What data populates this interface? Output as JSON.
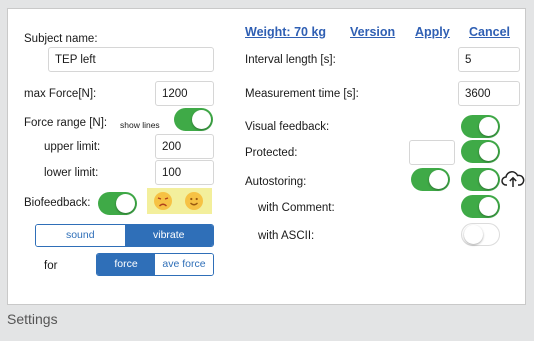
{
  "left": {
    "subject_label": "Subject name:",
    "subject_value": "TEP left",
    "max_force_label": "max Force[N]:",
    "max_force_value": "1200",
    "force_range_label": "Force range [N]:",
    "show_lines_label": "show lines",
    "upper_label": "upper limit:",
    "upper_value": "200",
    "lower_label": "lower limit:",
    "lower_value": "100",
    "biofeedback_label": "Biofeedback:",
    "mode_options": [
      "sound",
      "vibrate"
    ],
    "mode_selected": "vibrate",
    "for_label": "for",
    "for_options": [
      "force",
      "ave force"
    ],
    "for_selected": "force"
  },
  "top_links": {
    "weight": "Weight: 70 kg",
    "version": "Version",
    "apply": "Apply",
    "cancel": "Cancel"
  },
  "right": {
    "interval_label": "Interval length [s]:",
    "interval_value": "5",
    "measurement_label": "Measurement time [s]:",
    "measurement_value": "3600",
    "visual_label": "Visual feedback:",
    "protected_label": "Protected:",
    "autostoring_label": "Autostoring:",
    "comment_label": "with Comment:",
    "ascii_label": "with ASCII:"
  },
  "toggles": {
    "show_lines": true,
    "biofeedback": true,
    "visual_feedback": true,
    "protected": true,
    "autostoring_a": true,
    "autostoring_b": true,
    "with_comment": true,
    "with_ascii": false
  },
  "colors": {
    "toggle_on": "#3faa47",
    "link": "#2f5fb3",
    "segment": "#2f6fb8"
  },
  "caption": "Settings"
}
